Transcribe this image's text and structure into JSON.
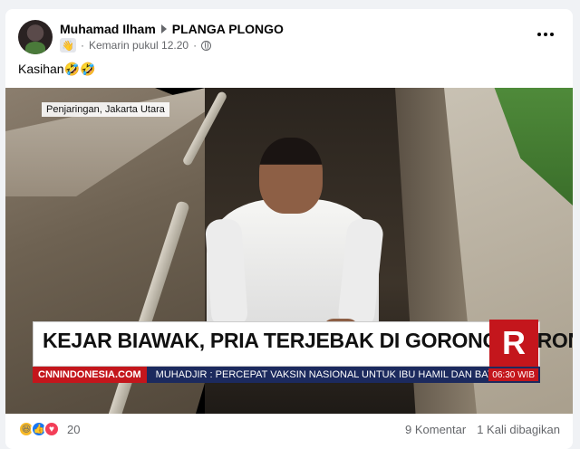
{
  "post": {
    "author": "Muhamad Ilham",
    "group": "PLANGA PLONGO",
    "timestamp": "Kemarin pukul 12.20",
    "privacy_icon": "globe-icon",
    "caption": "Kasihan🤣🤣"
  },
  "media": {
    "location_tag": "Penjaringan, Jakarta Utara",
    "headline": "KEJAR BIAWAK, PRIA TERJEBAK DI GORONG-GORONG",
    "brand_letter": "R",
    "ticker_source": "CNNINDONESIA.COM",
    "ticker_text": "MUHADJIR : PERCEPAT VAKSIN NASIONAL UNTUK IBU HAMIL DAN BAYI",
    "ticker_time": "06:30 WIB"
  },
  "footer": {
    "reaction_icons": [
      "haha-icon",
      "like-icon",
      "love-icon"
    ],
    "reaction_count": "20",
    "comments": "9 Komentar",
    "shares": "1 Kali dibagikan"
  },
  "colors": {
    "brand_red": "#c4161c",
    "ticker_blue": "#1c2a5e",
    "like_blue": "#1877f2",
    "love_red": "#f33e58",
    "haha_yellow": "#f7b928"
  }
}
